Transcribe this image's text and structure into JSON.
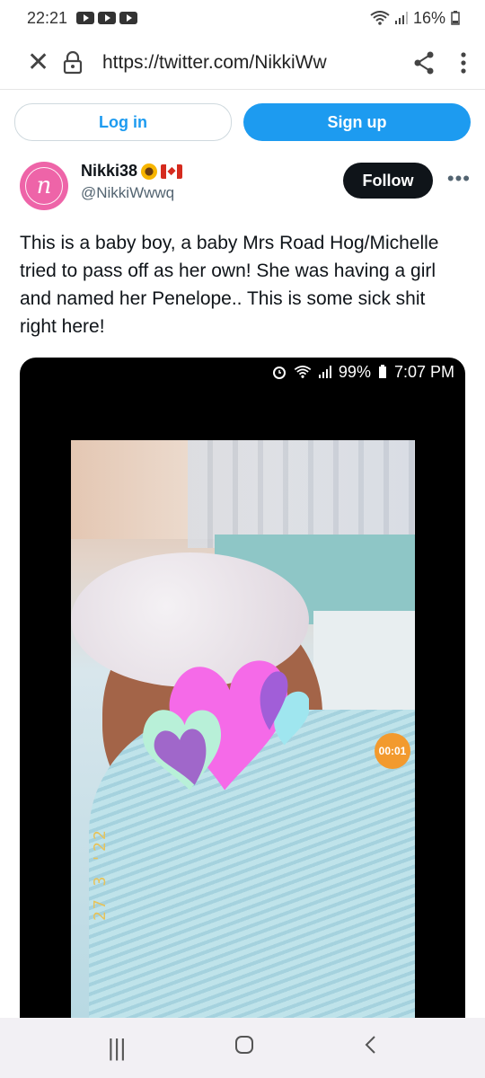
{
  "status_bar": {
    "time": "22:21",
    "battery": "16%"
  },
  "browser": {
    "url": "https://twitter.com/NikkiWw"
  },
  "auth": {
    "login_label": "Log in",
    "signup_label": "Sign up"
  },
  "tweet": {
    "display_name": "Nikki38",
    "handle": "@NikkiWwwq",
    "follow_label": "Follow",
    "text": "This is a baby boy, a baby Mrs Road Hog/Michelle tried to pass off as her own! She was having a girl and named her Penelope.. This is some sick shit right here!",
    "avatar_letter": "n"
  },
  "media": {
    "inner_status_battery": "99%",
    "inner_status_time": "7:07 PM",
    "timer_badge": "00:01",
    "date_stamp": "27 3 '22"
  },
  "colors": {
    "accent": "#1d9bf0",
    "follow_bg": "#0f1419",
    "avatar": "#ee64a8"
  }
}
